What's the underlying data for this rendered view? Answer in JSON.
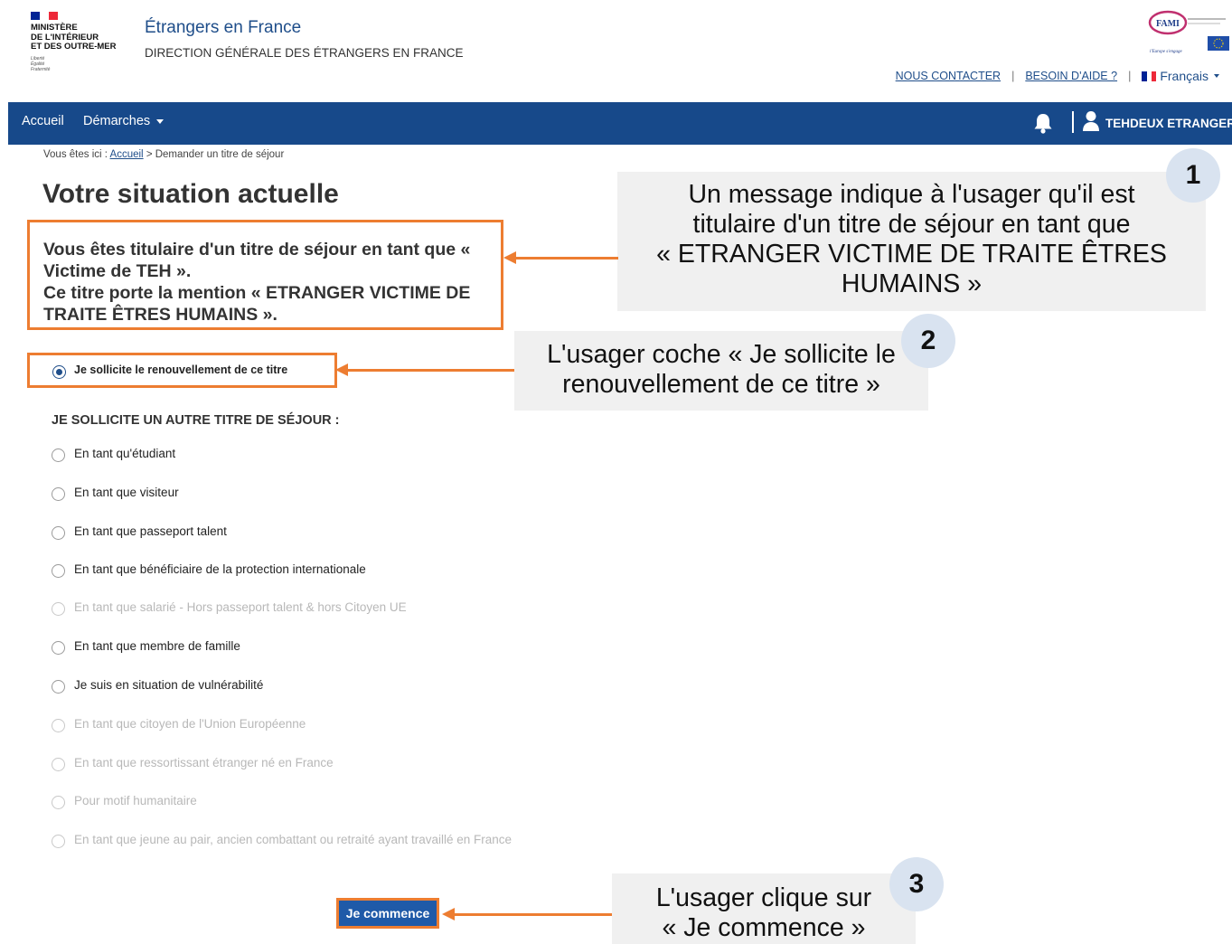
{
  "header": {
    "ministry_lines": [
      "MINISTÈRE",
      "DE L'INTÉRIEUR",
      "ET DES OUTRE-MER"
    ],
    "devise_lines": [
      "Liberté",
      "Égalité",
      "Fraternité"
    ],
    "site_title": "Étrangers en France",
    "site_subtitle": "DIRECTION GÉNÉRALE DES ÉTRANGERS EN FRANCE",
    "links": {
      "contact": "NOUS CONTACTER",
      "separator": "|",
      "help": "BESOIN D'AIDE ?",
      "language": "Français"
    },
    "logo_fami_text": "FAMI",
    "logo_fami_tagline": "l'Europe s'engage"
  },
  "nav": {
    "home": "Accueil",
    "procedures": "Démarches",
    "user_name": "TEHDEUX ETRANGER"
  },
  "breadcrumb": {
    "prefix": "Vous êtes ici :",
    "home": "Accueil",
    "separator": ">",
    "current": "Demander un titre de séjour"
  },
  "page_title": "Votre situation actuelle",
  "message": {
    "line1": "Vous êtes titulaire d'un titre de séjour en tant que «",
    "line2": "Victime de TEH ».",
    "line3": "Ce titre porte la mention « ETRANGER VICTIME DE",
    "line4": "TRAITE ÊTRES HUMAINS »."
  },
  "renewal_option": {
    "label": "Je sollicite le renouvellement de ce titre",
    "checked": true
  },
  "other_section_title": "JE SOLLICITE UN AUTRE TITRE DE SÉJOUR :",
  "other_options": [
    {
      "label": "En tant qu'étudiant",
      "disabled": false
    },
    {
      "label": "En tant que visiteur",
      "disabled": false
    },
    {
      "label": "En tant que passeport talent",
      "disabled": false
    },
    {
      "label": "En tant que bénéficiaire de la protection internationale",
      "disabled": false
    },
    {
      "label": "En tant que salarié - Hors passeport talent & hors Citoyen UE",
      "disabled": true
    },
    {
      "label": "En tant que membre de famille",
      "disabled": false
    },
    {
      "label": "Je suis en situation de vulnérabilité",
      "disabled": false
    },
    {
      "label": "En tant que citoyen de l'Union Européenne",
      "disabled": true
    },
    {
      "label": "En tant que ressortissant étranger né en France",
      "disabled": true
    },
    {
      "label": "Pour motif humanitaire",
      "disabled": true
    },
    {
      "label": "En tant que jeune au pair, ancien combattant ou retraité ayant travaillé en France",
      "disabled": true
    }
  ],
  "start_button": "Je commence",
  "annotations": [
    {
      "number": "1",
      "lines": [
        "Un message indique à l'usager qu'il est",
        "titulaire d'un titre de séjour en tant que",
        "« ETRANGER VICTIME DE TRAITE ÊTRES",
        "HUMAINS »"
      ]
    },
    {
      "number": "2",
      "lines": [
        "L'usager coche « Je sollicite le",
        "renouvellement de ce titre »"
      ]
    },
    {
      "number": "3",
      "lines": [
        "L'usager clique sur",
        "« Je commence »"
      ]
    }
  ],
  "colors": {
    "navbar": "#17498a",
    "annotation_orange": "#ed7d31",
    "callout_bg": "#f0f0f0",
    "badge_bg": "#d9e3f0",
    "button_blue": "#1f5aa8",
    "link_blue": "#1f4e8a"
  }
}
